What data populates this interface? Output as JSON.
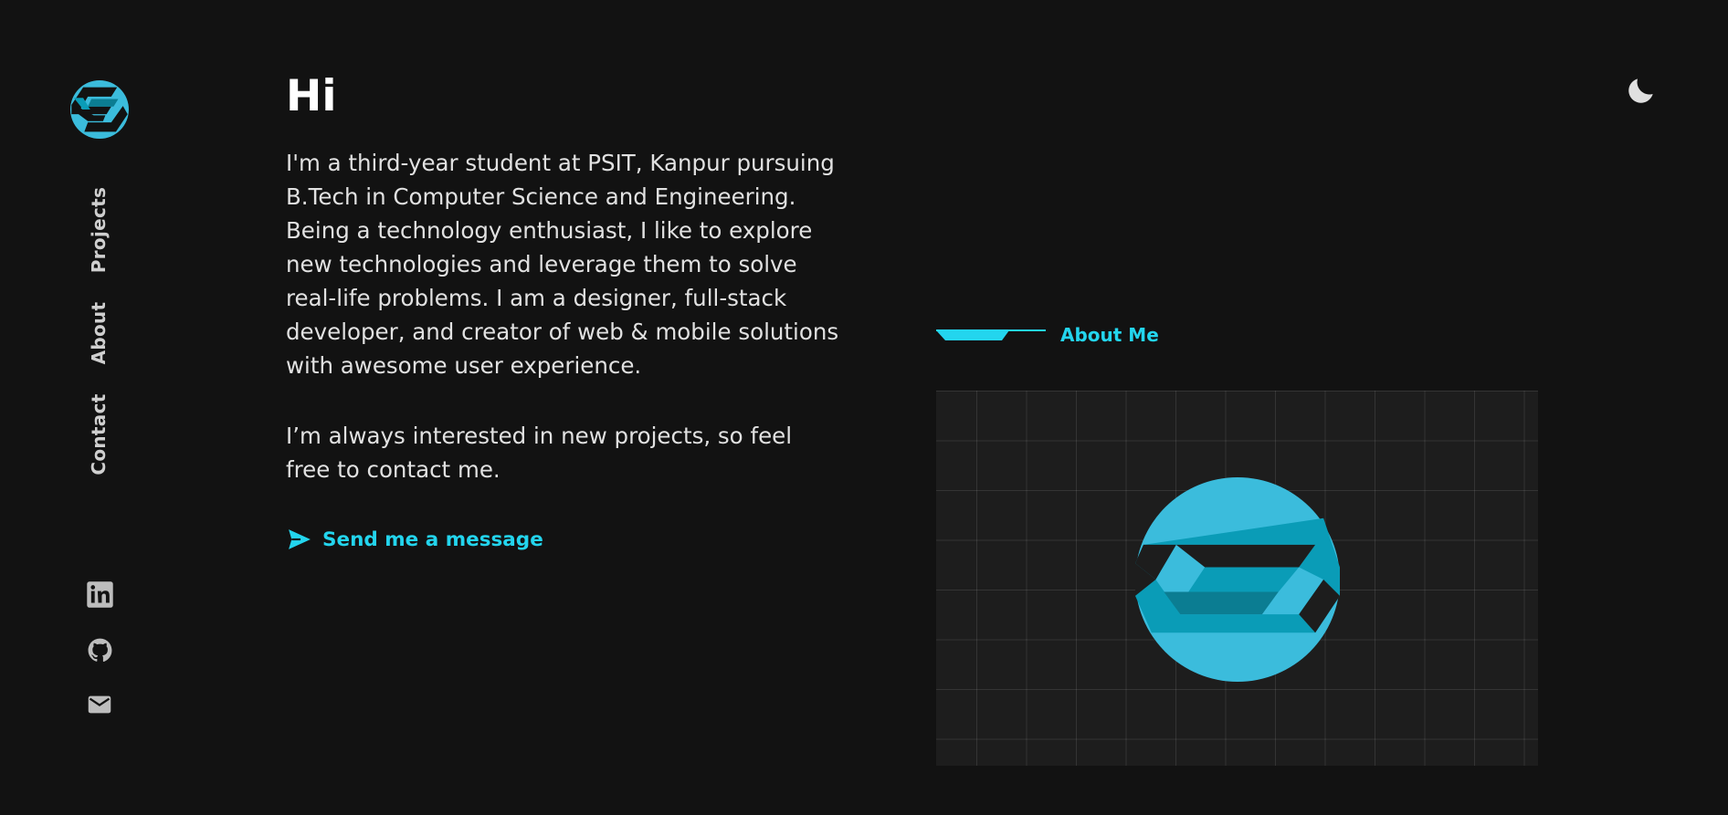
{
  "sidebar": {
    "logo_icon": "brand-s-logo-icon",
    "nav": [
      {
        "label": "Projects"
      },
      {
        "label": "About"
      },
      {
        "label": "Contact"
      }
    ],
    "social": [
      {
        "icon": "linkedin-icon"
      },
      {
        "icon": "github-icon"
      },
      {
        "icon": "mail-icon"
      }
    ]
  },
  "header": {
    "theme_toggle_icon": "moon-icon"
  },
  "hero": {
    "greeting": "Hi",
    "paragraph1": "I'm a third-year student at PSIT, Kanpur pursuing B.Tech in Computer Science and Engineering. Being a technology enthusiast, I like to explore new technologies and leverage them to solve real-life problems. I am a designer, full-stack developer, and creator of web & mobile solutions with awesome user experience.",
    "paragraph2": "I’m always interested in new projects, so feel free to contact me.",
    "cta_label": "Send me a message",
    "cta_icon": "send-icon"
  },
  "about": {
    "label": "About Me",
    "image_icon": "brand-s-logo-icon"
  },
  "colors": {
    "background": "#121212",
    "accent": "#23d5ee",
    "logo": "#3bbcdc",
    "text": "#e1e1e1"
  }
}
